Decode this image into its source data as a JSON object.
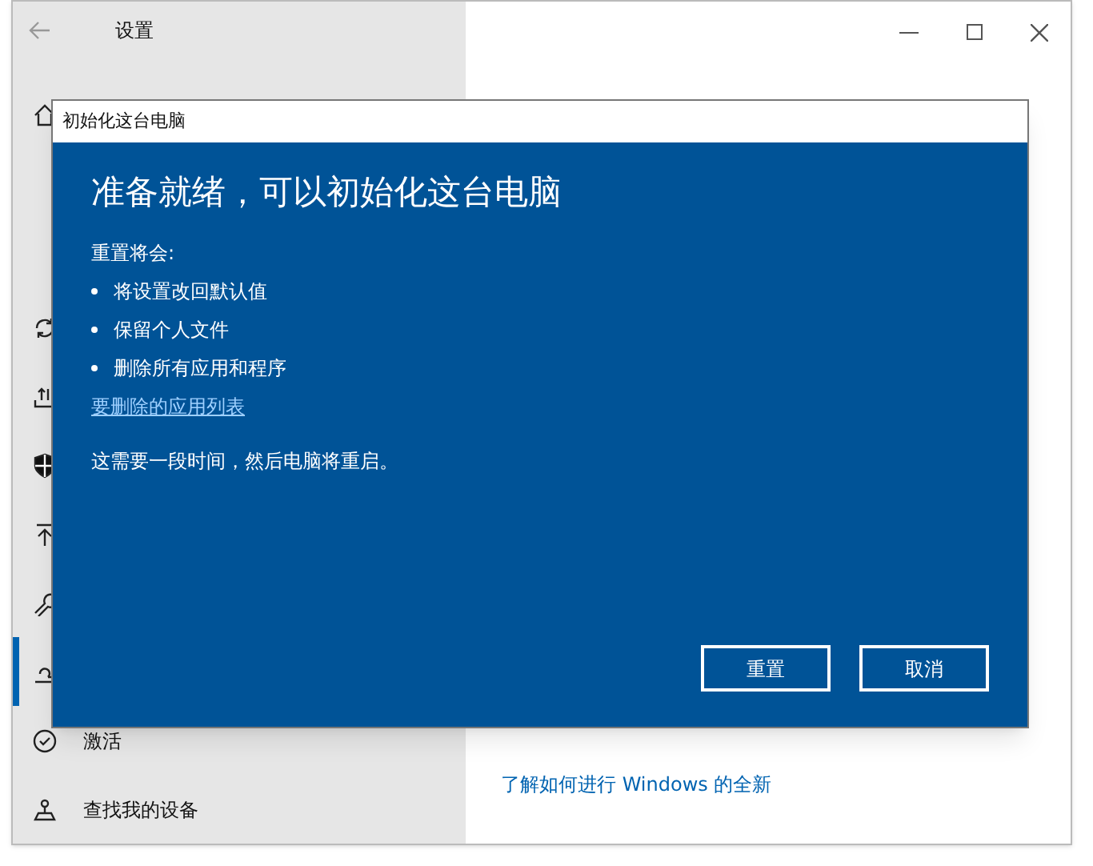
{
  "window": {
    "title": "设置"
  },
  "sidebar": {
    "items": [
      {
        "selected": false
      },
      {
        "selected": false
      },
      {
        "selected": false
      },
      {
        "selected": false
      },
      {
        "selected": false
      },
      {
        "selected": false
      },
      {
        "selected": true
      },
      {
        "label": "激活",
        "selected": false
      },
      {
        "label": "查找我的设备",
        "selected": false
      }
    ]
  },
  "content": {
    "link": "了解如何进行 Windows 的全新"
  },
  "dialog": {
    "title": "初始化这台电脑",
    "heading": "准备就绪，可以初始化这台电脑",
    "intro": "重置将会:",
    "bullets": [
      "将设置改回默认值",
      "保留个人文件",
      "删除所有应用和程序"
    ],
    "link": "要删除的应用列表",
    "note": "这需要一段时间，然后电脑将重启。",
    "buttons": [
      "重置",
      "取消"
    ]
  }
}
